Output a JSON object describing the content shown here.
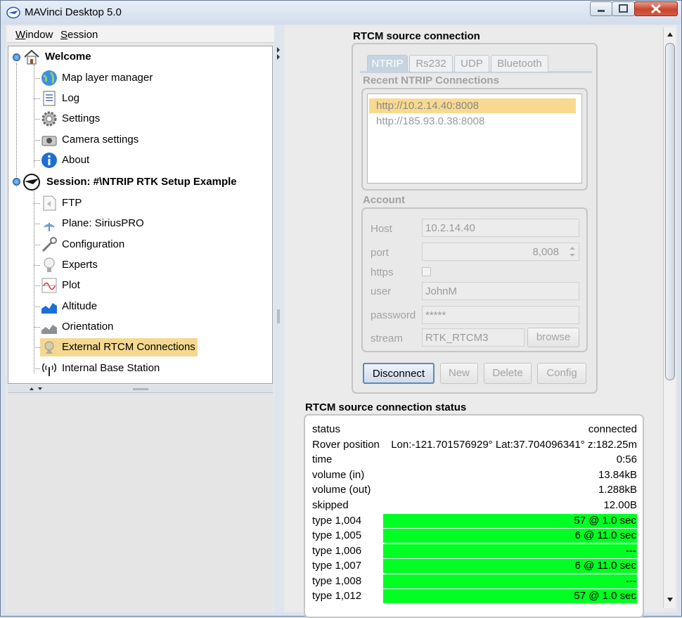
{
  "window": {
    "title": "MAVinci Desktop 5.0",
    "min_icon": "minimize-icon",
    "max_icon": "maximize-icon",
    "close_icon": "close-icon"
  },
  "menu": {
    "items": [
      {
        "mnemonic": "W",
        "rest": "indow"
      },
      {
        "mnemonic": "S",
        "rest": "ession"
      }
    ]
  },
  "tree": {
    "root1": {
      "label": "Welcome",
      "icon": "house-icon"
    },
    "root1_children": [
      {
        "label": "Map layer manager",
        "icon": "globe-icon"
      },
      {
        "label": "Log",
        "icon": "log-icon"
      },
      {
        "label": "Settings",
        "icon": "gear-icon"
      },
      {
        "label": "Camera settings",
        "icon": "camera-icon"
      },
      {
        "label": "About",
        "icon": "info-icon"
      }
    ],
    "root2": {
      "label": "Session: #\\NTRIP RTK Setup Example",
      "icon": "plane-icon"
    },
    "root2_children": [
      {
        "label": "FTP",
        "icon": "ftp-icon"
      },
      {
        "label": "Plane: SiriusPRO",
        "icon": "antenna-icon"
      },
      {
        "label": "Configuration",
        "icon": "wrench-icon"
      },
      {
        "label": "Experts",
        "icon": "lightbulb-icon"
      },
      {
        "label": "Plot",
        "icon": "plot-icon"
      },
      {
        "label": "Altitude",
        "icon": "altitude-icon"
      },
      {
        "label": "Orientation",
        "icon": "orientation-icon"
      },
      {
        "label": "External RTCM Connections",
        "icon": "satellite-icon"
      },
      {
        "label": "Internal Base Station",
        "icon": "radio-tower-icon"
      }
    ]
  },
  "rtcm": {
    "title": "RTCM source connection",
    "tabs": [
      "NTRIP",
      "Rs232",
      "UDP",
      "Bluetooth"
    ],
    "recent_title": "Recent NTRIP Connections",
    "recent": [
      "http://10.2.14.40:8008",
      "http://185.93.0.38:8008"
    ],
    "account_title": "Account",
    "host_label": "Host",
    "host_value": "10.2.14.40",
    "port_label": "port",
    "port_value": "8,008",
    "https_label": "https",
    "user_label": "user",
    "user_value": "JohnM",
    "password_label": "password",
    "password_value": "*****",
    "stream_label": "stream",
    "stream_value": "RTK_RTCM3",
    "browse_label": "browse",
    "disconnect_label": "Disconnect",
    "new_label": "New",
    "delete_label": "Delete",
    "config_label": "Config"
  },
  "status": {
    "title": "RTCM source connection status",
    "rows": [
      {
        "key": "status",
        "value": "connected"
      },
      {
        "key": "Rover position",
        "value": "Lon:-121.701576929° Lat:37.704096341° z:182.25m"
      },
      {
        "key": "time",
        "value": "0:56"
      },
      {
        "key": "volume (in)",
        "value": "13.84kB"
      },
      {
        "key": "volume (out)",
        "value": "1.288kB"
      },
      {
        "key": "skipped",
        "value": "12.00B"
      },
      {
        "key": "type 1,004",
        "value": "57 @ 1.0 sec"
      },
      {
        "key": "type 1,005",
        "value": "6 @ 11.0 sec"
      },
      {
        "key": "type 1,006",
        "value": "---"
      },
      {
        "key": "type 1,007",
        "value": "6 @ 11.0 sec"
      },
      {
        "key": "type 1,008",
        "value": "---"
      },
      {
        "key": "type 1,012",
        "value": "57 @ 1.0 sec"
      }
    ],
    "bar_color": "#00ff22"
  }
}
